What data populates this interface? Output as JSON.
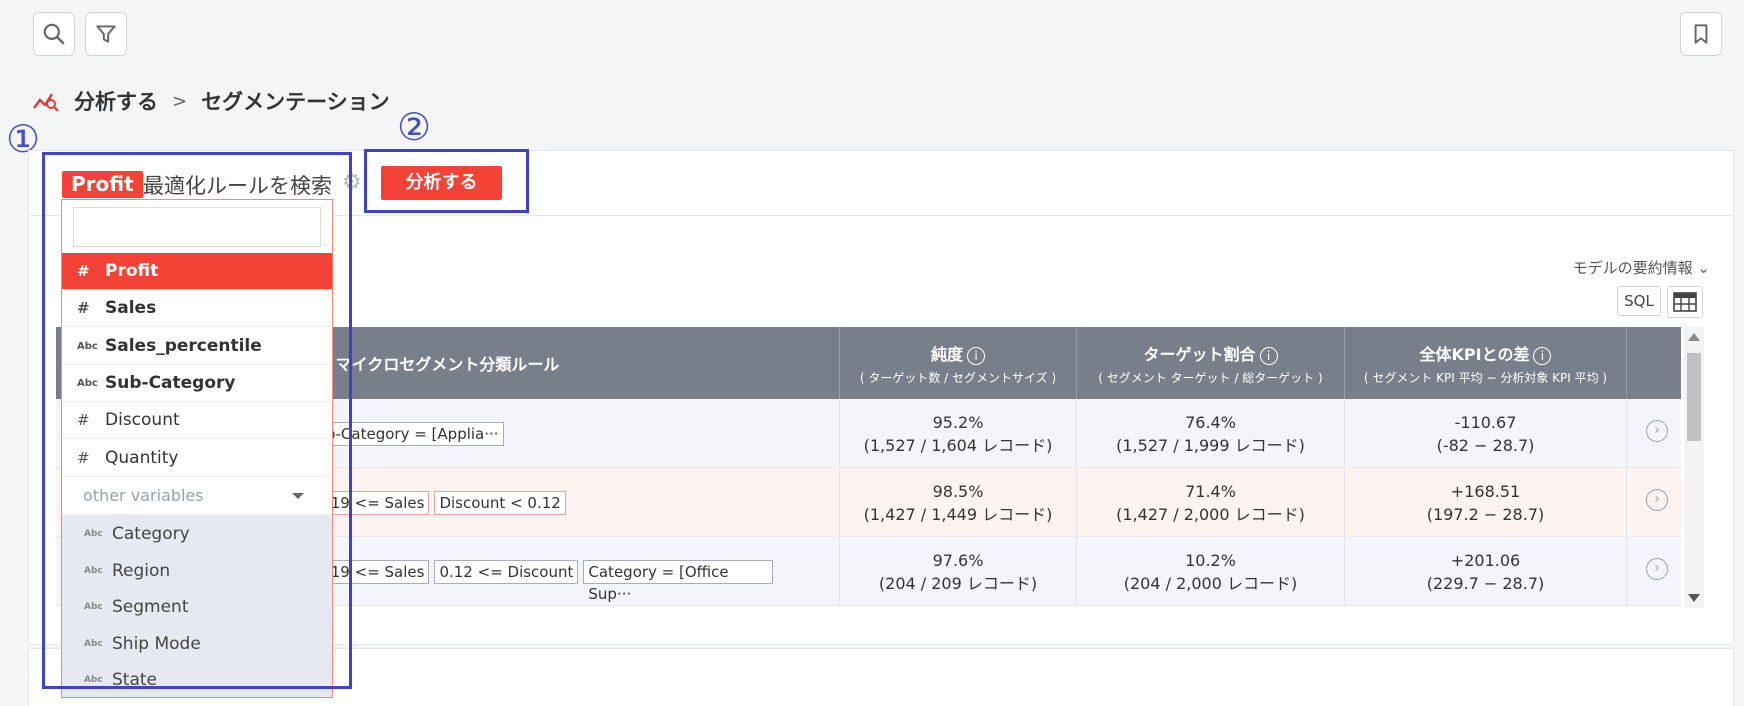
{
  "breadcrumb": {
    "section": "分析する",
    "separator": ">",
    "page": "セグメンテーション"
  },
  "markers": {
    "one": "①",
    "two": "②"
  },
  "toolbar": {
    "target_tag": "Profit",
    "search_label": "最適化ルールを検索",
    "analyze_button": "分析する"
  },
  "summary_link": "モデルの要約情報 ⌄",
  "sql_button": "SQL",
  "dropdown": {
    "search_value": "",
    "items": [
      {
        "icon": "#",
        "label": "Profit"
      },
      {
        "icon": "#",
        "label": "Sales"
      },
      {
        "icon": "Abc",
        "label": "Sales_percentile"
      },
      {
        "icon": "Abc",
        "label": "Sub-Category"
      },
      {
        "icon": "#",
        "label": "Discount"
      },
      {
        "icon": "#",
        "label": "Quantity"
      }
    ],
    "other_label": "other variables",
    "sub_items": [
      {
        "icon": "Abc",
        "label": "Category"
      },
      {
        "icon": "Abc",
        "label": "Region"
      },
      {
        "icon": "Abc",
        "label": "Segment"
      },
      {
        "icon": "Abc",
        "label": "Ship Mode"
      },
      {
        "icon": "Abc",
        "label": "State"
      }
    ]
  },
  "table": {
    "headers": {
      "rule": "マイクロセグメント分類ルール",
      "purity": "純度",
      "purity_sub": "( ターゲット数 / セグメントサイズ )",
      "target": "ターゲット割合",
      "target_sub": "( セグメント ターゲット / 総ターゲット )",
      "kpi": "全体KPIとの差",
      "kpi_sub": "( セグメント KPI 平均 − 分析対象 KPI 平均 )",
      "info": "i"
    },
    "rows": [
      {
        "chips": [
          "b-Category = [Applia···"
        ],
        "purity": "95.2%",
        "purity_detail": "(1,527 / 1,604 レコード)",
        "target": "76.4%",
        "target_detail": "(1,527 / 1,999 レコード)",
        "kpi": "-110.67",
        "kpi_detail": "(-82 − 28.7)"
      },
      {
        "chips": [
          ".19 <= Sales",
          "Discount < 0.12"
        ],
        "purity": "98.5%",
        "purity_detail": "(1,427 / 1,449 レコード)",
        "target": "71.4%",
        "target_detail": "(1,427 / 2,000 レコード)",
        "kpi": "+168.51",
        "kpi_detail": "(197.2 − 28.7)"
      },
      {
        "chips": [
          ".19 <= Sales",
          "0.12 <= Discount",
          "Category = [Office Sup···"
        ],
        "purity": "97.6%",
        "purity_detail": "(204 / 209 レコード)",
        "target": "10.2%",
        "target_detail": "(204 / 2,000 レコード)",
        "kpi": "+201.06",
        "kpi_detail": "(229.7 − 28.7)"
      }
    ],
    "row_action_icon": "›"
  },
  "colors": {
    "accent": "#f44336",
    "annotation": "#3f45c2",
    "header": "#787e8a"
  }
}
